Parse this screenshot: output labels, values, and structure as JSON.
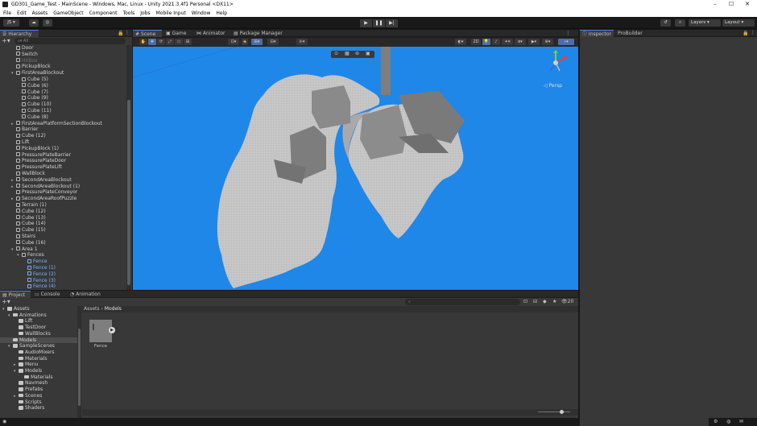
{
  "window": {
    "title": "GD301_Game_Test - MainScene - Windows, Mac, Linux - Unity 2021.3.4f1 Personal <DX11>",
    "min_glyph": "–",
    "max_glyph": "☐",
    "close_glyph": "✕"
  },
  "menu": [
    "File",
    "Edit",
    "Assets",
    "GameObject",
    "Component",
    "Tools",
    "Jobs",
    "Mobile Input",
    "Window",
    "Help"
  ],
  "toolbar": {
    "account": "JS ▾",
    "layers": "Layers",
    "layout": "Layout"
  },
  "hierarchy": {
    "title": "Hierarchy",
    "search_placeholder": "All",
    "items": [
      {
        "label": "Door",
        "indent": 2,
        "arrow": "",
        "style": ""
      },
      {
        "label": "Switch",
        "indent": 2,
        "arrow": "",
        "style": ""
      },
      {
        "label": "HitBox",
        "indent": 2,
        "arrow": "",
        "style": "gray"
      },
      {
        "label": "PickupBlock",
        "indent": 2,
        "arrow": "",
        "style": ""
      },
      {
        "label": "FirstAreaBlockout",
        "indent": 2,
        "arrow": "▾",
        "style": ""
      },
      {
        "label": "Cube (5)",
        "indent": 3,
        "arrow": "",
        "style": ""
      },
      {
        "label": "Cube (6)",
        "indent": 3,
        "arrow": "",
        "style": ""
      },
      {
        "label": "Cube (7)",
        "indent": 3,
        "arrow": "",
        "style": ""
      },
      {
        "label": "Cube (9)",
        "indent": 3,
        "arrow": "",
        "style": ""
      },
      {
        "label": "Cube (10)",
        "indent": 3,
        "arrow": "",
        "style": ""
      },
      {
        "label": "Cube (11)",
        "indent": 3,
        "arrow": "",
        "style": ""
      },
      {
        "label": "Cube (8)",
        "indent": 3,
        "arrow": "",
        "style": ""
      },
      {
        "label": "FirstAreaPlatformSectionBlockout",
        "indent": 2,
        "arrow": "▸",
        "style": ""
      },
      {
        "label": "Barrier",
        "indent": 2,
        "arrow": "",
        "style": ""
      },
      {
        "label": "Cube (12)",
        "indent": 2,
        "arrow": "",
        "style": ""
      },
      {
        "label": "Lift",
        "indent": 2,
        "arrow": "",
        "style": ""
      },
      {
        "label": "PickupBlock (1)",
        "indent": 2,
        "arrow": "",
        "style": ""
      },
      {
        "label": "PressurePlateBarrier",
        "indent": 2,
        "arrow": "",
        "style": ""
      },
      {
        "label": "PressurePlateDoor",
        "indent": 2,
        "arrow": "",
        "style": ""
      },
      {
        "label": "PressurePlateLift",
        "indent": 2,
        "arrow": "",
        "style": ""
      },
      {
        "label": "WallBlock",
        "indent": 2,
        "arrow": "",
        "style": ""
      },
      {
        "label": "SecondAreaBlockout",
        "indent": 2,
        "arrow": "▸",
        "style": ""
      },
      {
        "label": "SecondAreaBlockout (1)",
        "indent": 2,
        "arrow": "▸",
        "style": ""
      },
      {
        "label": "PressurePlateConveyor",
        "indent": 2,
        "arrow": "",
        "style": ""
      },
      {
        "label": "SecondAreaRoofPuzzle",
        "indent": 2,
        "arrow": "▸",
        "style": ""
      },
      {
        "label": "Terrain (1)",
        "indent": 2,
        "arrow": "",
        "style": ""
      },
      {
        "label": "Cube (12)",
        "indent": 2,
        "arrow": "",
        "style": ""
      },
      {
        "label": "Cube (13)",
        "indent": 2,
        "arrow": "",
        "style": ""
      },
      {
        "label": "Cube (14)",
        "indent": 2,
        "arrow": "",
        "style": ""
      },
      {
        "label": "Cube (15)",
        "indent": 2,
        "arrow": "",
        "style": ""
      },
      {
        "label": "Stairs",
        "indent": 2,
        "arrow": "",
        "style": ""
      },
      {
        "label": "Cube (16)",
        "indent": 2,
        "arrow": "",
        "style": ""
      },
      {
        "label": "Area 1",
        "indent": 2,
        "arrow": "▾",
        "style": ""
      },
      {
        "label": "Fences",
        "indent": 3,
        "arrow": "▾",
        "style": ""
      },
      {
        "label": "Fence",
        "indent": 4,
        "arrow": "",
        "style": "sel"
      },
      {
        "label": "Fence (1)",
        "indent": 4,
        "arrow": "",
        "style": "sel"
      },
      {
        "label": "Fence (2)",
        "indent": 4,
        "arrow": "",
        "style": "sel"
      },
      {
        "label": "Fence (3)",
        "indent": 4,
        "arrow": "",
        "style": "sel"
      },
      {
        "label": "Fence (4)",
        "indent": 4,
        "arrow": "",
        "style": "sel"
      }
    ]
  },
  "scene": {
    "tabs": [
      "Scene",
      "Game",
      "Animator",
      "Package Manager"
    ],
    "mode_2d": "2D",
    "gizmo_label": "◁ Persp",
    "sky_color": "#1f87e8"
  },
  "inspector": {
    "tabs": [
      "Inspector",
      "ProBuilder"
    ]
  },
  "project": {
    "tabs": [
      "Project",
      "Console",
      "Animation"
    ],
    "breadcrumb_root": "Assets",
    "breadcrumb_sep": "›",
    "breadcrumb_current": "Models",
    "item_count": "20",
    "tree": [
      {
        "label": "Assets",
        "indent": 0,
        "arrow": "▾",
        "sel": false
      },
      {
        "label": "Animations",
        "indent": 1,
        "arrow": "▾",
        "sel": false
      },
      {
        "label": "Lift",
        "indent": 2,
        "arrow": "",
        "sel": false
      },
      {
        "label": "TestDoor",
        "indent": 2,
        "arrow": "",
        "sel": false
      },
      {
        "label": "WallBlocks",
        "indent": 2,
        "arrow": "",
        "sel": false
      },
      {
        "label": "Models",
        "indent": 1,
        "arrow": "",
        "sel": true
      },
      {
        "label": "SampleScenes",
        "indent": 1,
        "arrow": "▾",
        "sel": false
      },
      {
        "label": "AudioMixers",
        "indent": 2,
        "arrow": "",
        "sel": false
      },
      {
        "label": "Materials",
        "indent": 2,
        "arrow": "",
        "sel": false
      },
      {
        "label": "Menu",
        "indent": 2,
        "arrow": "▸",
        "sel": false
      },
      {
        "label": "Models",
        "indent": 2,
        "arrow": "▾",
        "sel": false
      },
      {
        "label": "Materials",
        "indent": 3,
        "arrow": "",
        "sel": false
      },
      {
        "label": "Navmesh",
        "indent": 2,
        "arrow": "",
        "sel": false
      },
      {
        "label": "Prefabs",
        "indent": 2,
        "arrow": "",
        "sel": false
      },
      {
        "label": "Scenes",
        "indent": 2,
        "arrow": "▸",
        "sel": false
      },
      {
        "label": "Scripts",
        "indent": 2,
        "arrow": "",
        "sel": false
      },
      {
        "label": "Shaders",
        "indent": 2,
        "arrow": "",
        "sel": false
      }
    ],
    "assets": [
      {
        "label": "Fence"
      }
    ]
  }
}
